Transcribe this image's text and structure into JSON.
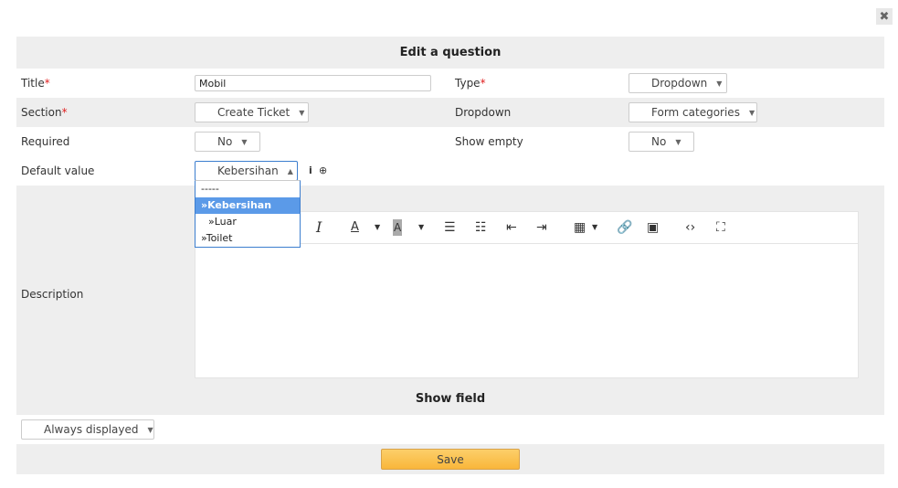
{
  "close_glyph": "✖",
  "dialog": {
    "title": "Edit a question"
  },
  "fields": {
    "title": {
      "label": "Title",
      "required": "*",
      "value": "Mobil"
    },
    "type": {
      "label": "Type",
      "required": "*",
      "value": "Dropdown"
    },
    "section": {
      "label": "Section",
      "required": "*",
      "value": "Create Ticket"
    },
    "dropdown": {
      "label": "Dropdown",
      "value": "Form categories"
    },
    "required": {
      "label": "Required",
      "value": "No"
    },
    "show_empty": {
      "label": "Show empty",
      "value": "No"
    },
    "default_value": {
      "label": "Default value",
      "value": "Kebersihan",
      "options": [
        "-----",
        "»Kebersihan",
        "»Luar",
        "»Toilet"
      ],
      "selected_index": 1
    },
    "description": {
      "label": "Description"
    }
  },
  "toolbar_icons": [
    "italic-icon",
    "font-color-icon",
    "background-color-icon",
    "bullet-list-icon",
    "numbered-list-icon",
    "outdent-icon",
    "indent-icon",
    "table-icon",
    "link-icon",
    "image-icon",
    "code-icon",
    "fullscreen-icon"
  ],
  "show_field": {
    "title": "Show field",
    "display": "Always displayed"
  },
  "save_label": "Save",
  "colors": {
    "header_bg": "#eeeeee",
    "required": "#e02020",
    "selected_option": "#5b9ae8",
    "save_button": "#f9b63a"
  }
}
